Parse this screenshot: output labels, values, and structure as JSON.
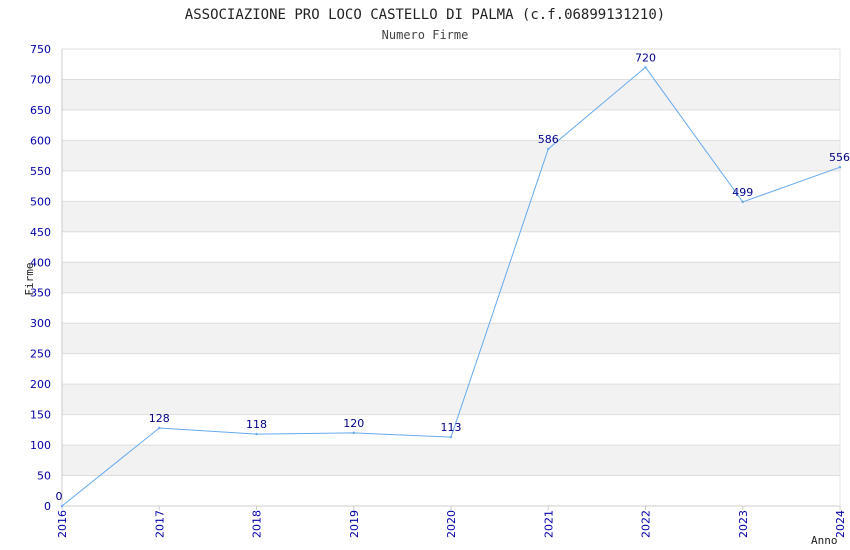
{
  "chart_data": {
    "type": "line",
    "title": "ASSOCIAZIONE PRO LOCO CASTELLO DI PALMA (c.f.06899131210)",
    "subtitle": "Numero Firme",
    "xlabel": "Anno",
    "ylabel": "Firme",
    "x": [
      "2016",
      "2017",
      "2018",
      "2019",
      "2020",
      "2021",
      "2022",
      "2023",
      "2024"
    ],
    "series": [
      {
        "values": [
          0,
          128,
          118,
          120,
          113,
          586,
          720,
          499,
          556
        ]
      }
    ],
    "ylim": [
      0,
      750
    ],
    "yticks": [
      "0",
      "50",
      "100",
      "150",
      "200",
      "250",
      "300",
      "350",
      "400",
      "450",
      "500",
      "550",
      "600",
      "650",
      "700",
      "750"
    ],
    "data_labels": [
      "0",
      "128",
      "118",
      "120",
      "113",
      "586",
      "720",
      "499",
      "556"
    ],
    "grid": true,
    "colors": {
      "line": "#66aaee",
      "band": "#f2f2f2",
      "grid": "#dddddd",
      "tick_text": "#0000aa",
      "label_text": "#000088"
    }
  }
}
